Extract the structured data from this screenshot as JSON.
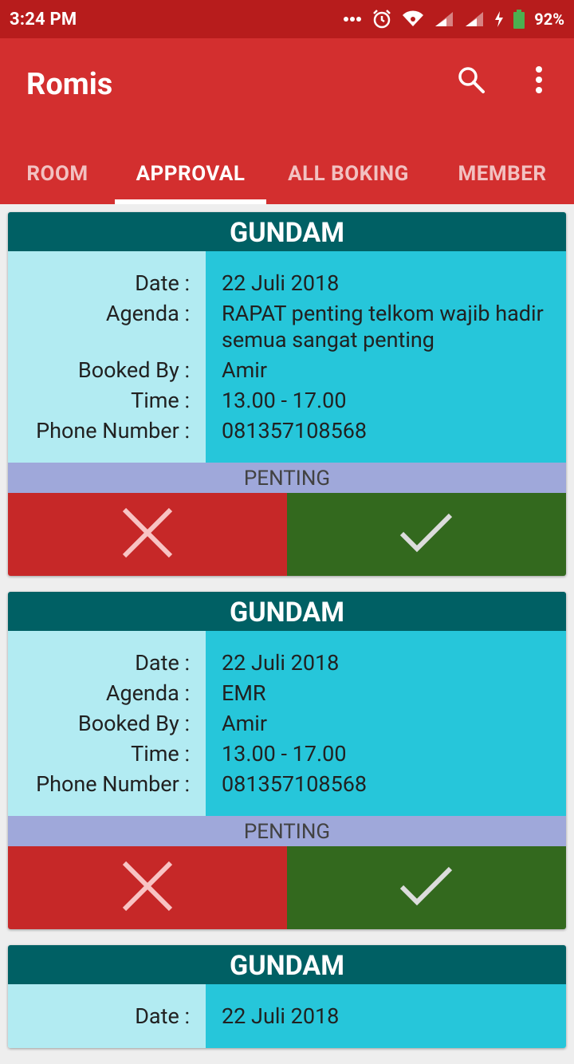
{
  "status_bar": {
    "time": "3:24 PM",
    "battery": "92%",
    "icons": [
      "more-dots-icon",
      "alarm-icon",
      "wifi-icon",
      "signal-icon",
      "signal-icon",
      "charging-icon",
      "battery-icon"
    ]
  },
  "app_bar": {
    "title": "Romis",
    "actions": [
      "search-icon",
      "more-vert-icon"
    ]
  },
  "tabs": [
    {
      "label": "ROOM",
      "active": false
    },
    {
      "label": "APPROVAL",
      "active": true
    },
    {
      "label": "ALL BOKING",
      "active": false
    },
    {
      "label": "MEMBER",
      "active": false
    }
  ],
  "field_labels": {
    "date": "Date :",
    "agenda": "Agenda :",
    "booked_by": "Booked By :",
    "time": "Time :",
    "phone": "Phone Number :"
  },
  "bookings": [
    {
      "room": "GUNDAM",
      "date": "22 Juli 2018",
      "agenda": "RAPAT penting telkom wajib hadir semua sangat penting",
      "booked_by": "Amir",
      "time": "13.00 - 17.00",
      "phone": "081357108568",
      "priority": "PENTING"
    },
    {
      "room": "GUNDAM",
      "date": "22 Juli 2018",
      "agenda": "EMR",
      "booked_by": "Amir",
      "time": "13.00 - 17.00",
      "phone": "081357108568",
      "priority": "PENTING"
    },
    {
      "room": "GUNDAM",
      "date": "22 Juli 2018"
    }
  ],
  "colors": {
    "status_bar": "#b71c1c",
    "app_bar": "#d32f2f",
    "card_header": "#006064",
    "labels_bg": "#b2ebf2",
    "values_bg": "#26c6da",
    "priority_bg": "#9fa8da",
    "reject": "#c62828",
    "approve": "#33691e"
  }
}
